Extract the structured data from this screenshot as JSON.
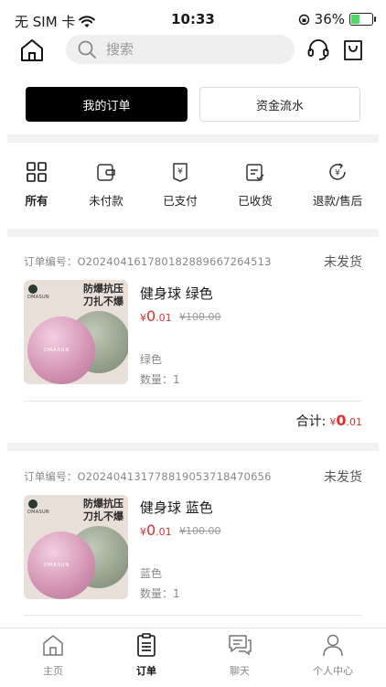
{
  "status_bar": {
    "carrier": "无 SIM 卡",
    "time": "10:33",
    "battery": "36%",
    "battery_level": 0.36,
    "icons": [
      "wifi-icon",
      "orientation-lock-icon",
      "battery-charging-icon"
    ]
  },
  "header": {
    "search_placeholder": "搜索",
    "icons": [
      "home-icon",
      "search-icon",
      "headset-icon",
      "shopping-bag-icon"
    ]
  },
  "segments": {
    "orders": "我的订单",
    "funds": "资金流水",
    "selected": "orders"
  },
  "status_tabs": [
    {
      "label": "所有",
      "icon": "grid-icon",
      "active": true
    },
    {
      "label": "未付款",
      "icon": "wallet-icon",
      "active": false
    },
    {
      "label": "已支付",
      "icon": "paid-receipt-icon",
      "active": false
    },
    {
      "label": "已收货",
      "icon": "received-box-icon",
      "active": false
    },
    {
      "label": "退款/售后",
      "icon": "refund-icon",
      "active": false
    }
  ],
  "orders": [
    {
      "order_no": "订单编号：O202404161780182889667264513",
      "status": "未发货",
      "product_name": "健身球 绿色",
      "price_symbol": "¥",
      "price_int": "0",
      "price_dec": ".01",
      "original_price": "¥100.00",
      "spec": "绿色",
      "quantity": "数量：1",
      "image_brand": "DMASUN",
      "image_slogan_1": "防爆抗压",
      "image_slogan_2": "刀扎不爆",
      "total_label": "合计:",
      "total_symbol": "¥",
      "total_int": "0",
      "total_dec": ".01"
    },
    {
      "order_no": "订单编号：O202404131778819053718470656",
      "status": "未发货",
      "product_name": "健身球 蓝色",
      "price_symbol": "¥",
      "price_int": "0",
      "price_dec": ".01",
      "original_price": "¥100.00",
      "spec": "蓝色",
      "quantity": "数量：1",
      "image_brand": "DMASUN",
      "image_slogan_1": "防爆抗压",
      "image_slogan_2": "刀扎不爆"
    }
  ],
  "bottom_nav": [
    {
      "label": "主页",
      "icon": "home-icon",
      "active": false
    },
    {
      "label": "订单",
      "icon": "order-list-icon",
      "active": true
    },
    {
      "label": "聊天",
      "icon": "chat-icon",
      "active": false
    },
    {
      "label": "个人中心",
      "icon": "person-icon",
      "active": false
    }
  ],
  "colors": {
    "accent": "#000000",
    "price_red": "#e0302c",
    "band_gray": "#f2f2f2"
  }
}
